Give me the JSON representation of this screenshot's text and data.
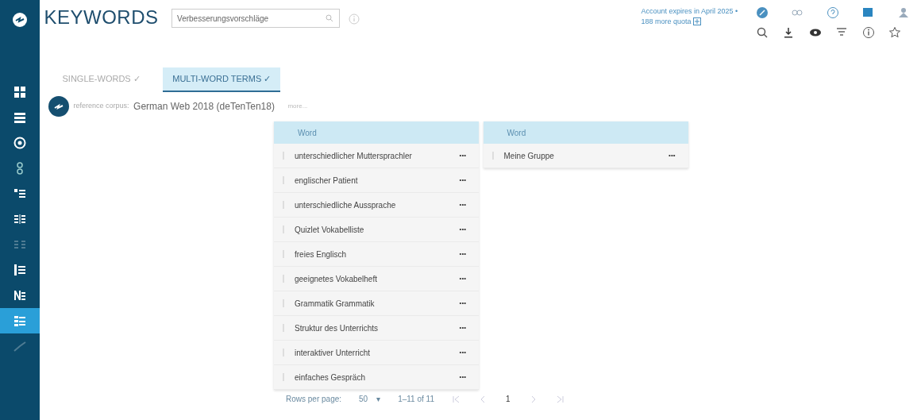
{
  "app": {
    "title": "KEYWORDS",
    "search": {
      "value": "Verbesserungsvorschläge"
    },
    "account": {
      "line_1": "Account expires in April 2025 •",
      "line_2": "188 more quota"
    }
  },
  "tabs": [
    {
      "label": "SINGLE-WORDS ✓",
      "selected": false
    },
    {
      "label": "MULTI-WORD TERMS ✓",
      "selected": true
    }
  ],
  "corpus": {
    "label": "reference corpus:",
    "name": "German Web 2018 (deTenTen18)",
    "note": "more..."
  },
  "sidebar": {
    "items": [
      {
        "selected": false
      },
      {
        "selected": false
      },
      {
        "selected": false
      },
      {
        "selected": false
      },
      {
        "selected": false
      },
      {
        "selected": false
      },
      {
        "selected": false
      },
      {
        "selected": false
      },
      {
        "selected": false
      },
      {
        "selected": true
      },
      {
        "selected": false
      }
    ]
  },
  "tables": [
    {
      "column": "Word",
      "rows": [
        {
          "word": "unterschiedlicher Muttersprachler",
          "menu": "•••"
        },
        {
          "word": "englischer Patient",
          "menu": "•••"
        },
        {
          "word": "unterschiedliche Aussprache",
          "menu": "•••"
        },
        {
          "word": "Quizlet Vokabelliste",
          "menu": "•••"
        },
        {
          "word": "freies Englisch",
          "menu": "•••"
        },
        {
          "word": "geeignetes Vokabelheft",
          "menu": "•••"
        },
        {
          "word": "Grammatik Grammatik",
          "menu": "•••"
        },
        {
          "word": "Struktur des Unterrichts",
          "menu": "•••"
        },
        {
          "word": "interaktiver Unterricht",
          "menu": "•••"
        },
        {
          "word": "einfaches Gespräch",
          "menu": "•••"
        }
      ]
    },
    {
      "column": "Word",
      "rows": [
        {
          "word": "Meine Gruppe",
          "menu": "•••"
        }
      ]
    }
  ],
  "pagination": {
    "label": "Rows per page:",
    "per_page": "50",
    "caret": "▾",
    "range": "1–11 of 11",
    "page": "1"
  }
}
